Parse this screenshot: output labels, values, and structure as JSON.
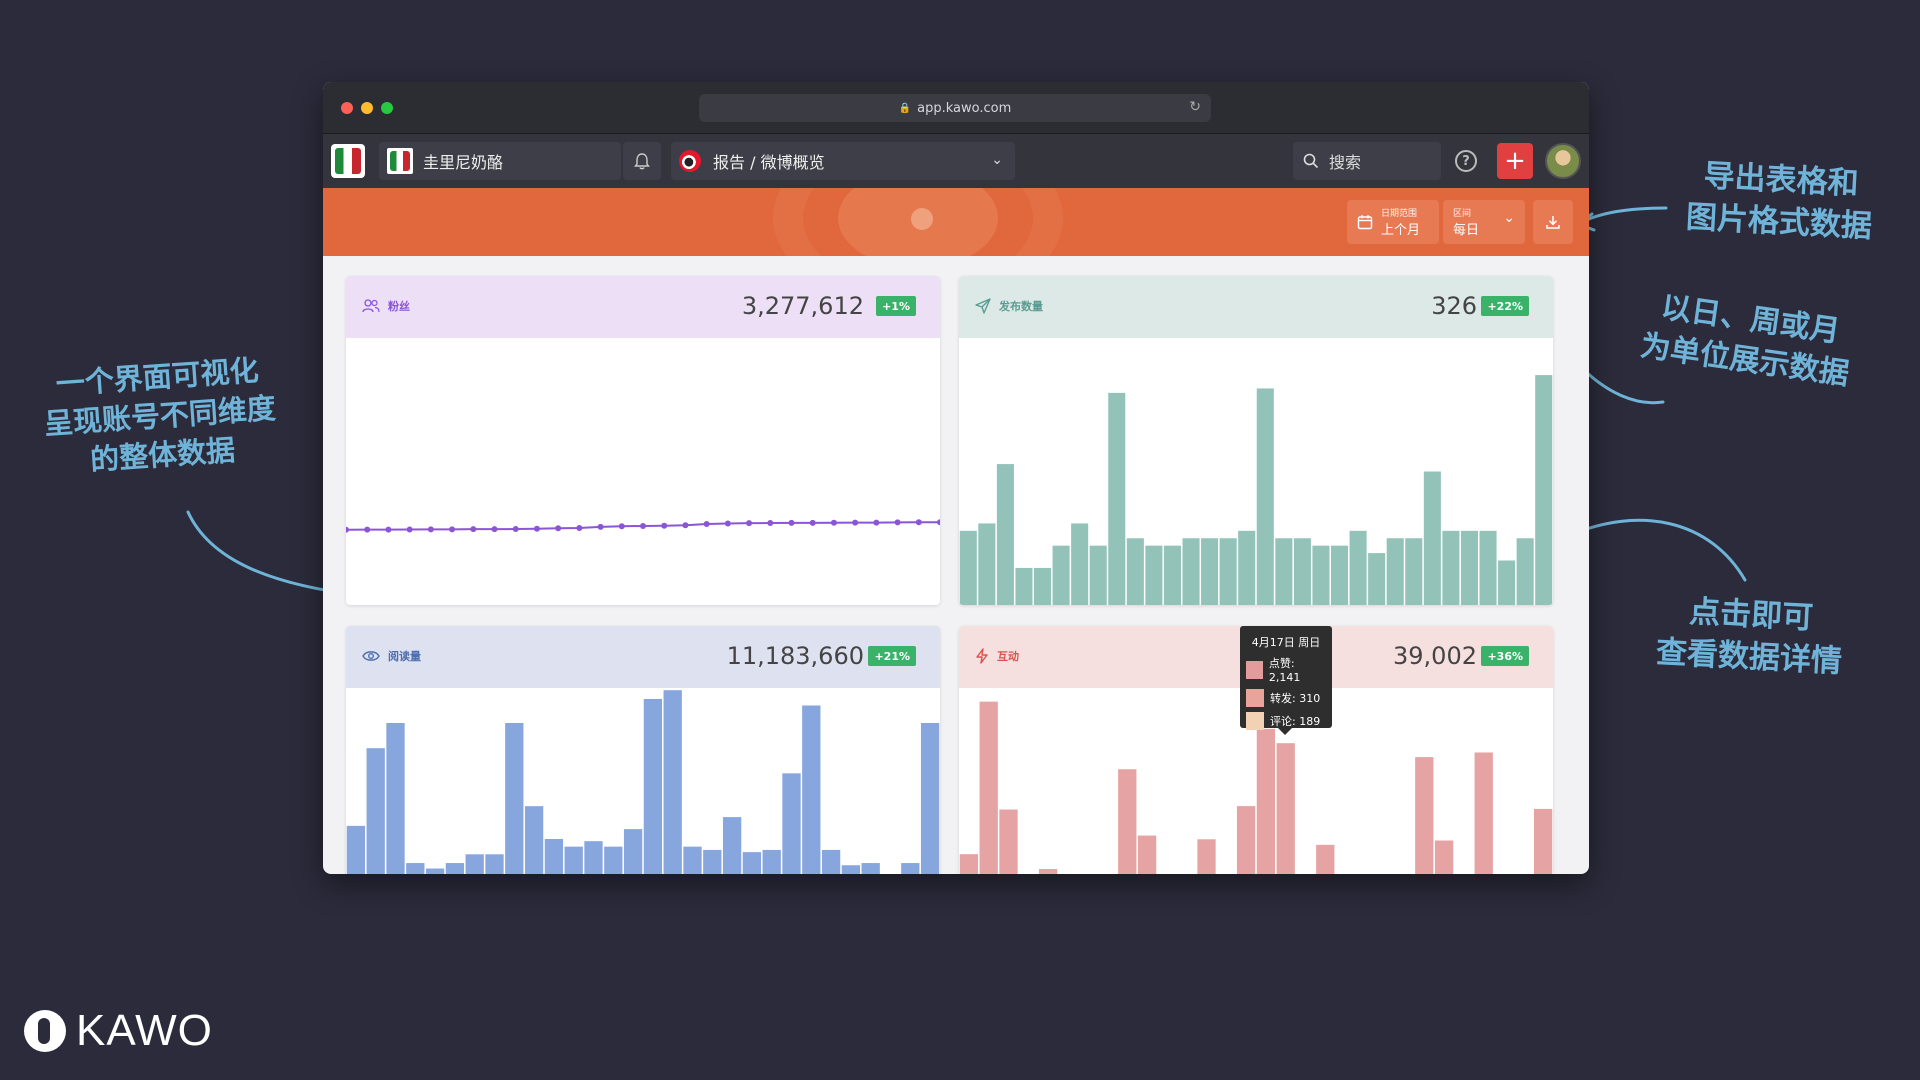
{
  "window": {
    "url": "app.kawo.com",
    "dot_colors": [
      "#fe5f57",
      "#febc2e",
      "#28c840"
    ]
  },
  "appbar": {
    "account_name": "圭里尼奶酪",
    "report_title": "报告 / 微博概览",
    "search_label": "搜索",
    "help_glyph": "?",
    "add_glyph": "+"
  },
  "controls": {
    "date_range_label": "日期范围",
    "date_range_value": "上个月",
    "interval_label": "区间",
    "interval_value": "每日"
  },
  "cards": {
    "fans": {
      "label": "粉丝",
      "value": "3,277,612",
      "delta": "+1%",
      "color": "#8a55d6",
      "head_bg": "#ecdff6"
    },
    "posts": {
      "label": "发布数量",
      "value": "326",
      "delta": "+22%",
      "color": "#5a9d92",
      "head_bg": "#dce9e6"
    },
    "reads": {
      "label": "阅读量",
      "value": "11,183,660",
      "delta": "+21%",
      "color": "#4f6fb0",
      "head_bg": "#dde1f0"
    },
    "engage": {
      "label": "互动",
      "value": "39,002",
      "delta": "+36%",
      "color": "#d9534f",
      "head_bg": "#f6dfdf"
    }
  },
  "tooltip": {
    "date": "4月17日 周日",
    "rows": [
      {
        "label": "点赞: 2,141",
        "color": "#e39b9b"
      },
      {
        "label": "转发: 310",
        "color": "#e8a49a"
      },
      {
        "label": "评论: 189",
        "color": "#f3d1b5"
      }
    ]
  },
  "annotations": {
    "left": [
      "一个界面可视化",
      "呈现账号不同维度",
      "的整体数据"
    ],
    "top_right": [
      "导出表格和",
      "图片格式数据"
    ],
    "mid_right": [
      "以日、周或月",
      "为单位展示数据"
    ],
    "bottom_right": [
      "点击即可",
      "查看数据详情"
    ]
  },
  "brand": "KAWO",
  "chart_data": [
    {
      "type": "line",
      "series": [
        {
          "values": [
            18.5,
            18.6,
            18.6,
            18.7,
            18.8,
            18.8,
            18.9,
            18.9,
            19.0,
            19.2,
            19.5,
            19.7,
            20.5,
            20.9,
            21.1,
            21.2,
            21.6,
            22.4,
            22.8,
            23.0,
            23.1,
            23.2,
            23.2,
            23.3,
            23.4,
            23.4,
            23.5,
            23.6,
            23.6
          ]
        }
      ],
      "ylim": [
        0,
        100
      ]
    },
    {
      "type": "bar",
      "values": [
        5,
        5.5,
        9.5,
        2.5,
        2.5,
        4,
        5.5,
        4,
        14.3,
        4.5,
        4,
        4,
        4.5,
        4.5,
        4.5,
        5,
        14.6,
        4.5,
        4.5,
        4,
        4,
        5,
        3.5,
        4.5,
        4.5,
        9,
        5,
        5,
        5,
        3,
        4.5,
        15.5
      ],
      "ylim": [
        0,
        18
      ]
    },
    {
      "type": "bar",
      "values": [
        4.4,
        11.5,
        13.8,
        1,
        0.5,
        1,
        1.8,
        1.8,
        13.8,
        6.2,
        3.2,
        2.5,
        3,
        2.5,
        4.1,
        16,
        16.8,
        2.5,
        2.2,
        5.2,
        2,
        2.2,
        9.2,
        15.4,
        2.2,
        0.8,
        1,
        0,
        1,
        13.8
      ],
      "ylim": [
        0,
        17
      ]
    },
    {
      "type": "bar",
      "values": [
        320,
        2780,
        1040,
        0,
        80,
        0,
        0,
        0,
        1690,
        620,
        0,
        0,
        560,
        0,
        1095,
        2341,
        2110,
        0,
        470,
        0,
        0,
        0,
        0,
        1885,
        540,
        0,
        1960,
        0,
        0,
        1050
      ],
      "ylim": [
        0,
        3000
      ]
    }
  ]
}
